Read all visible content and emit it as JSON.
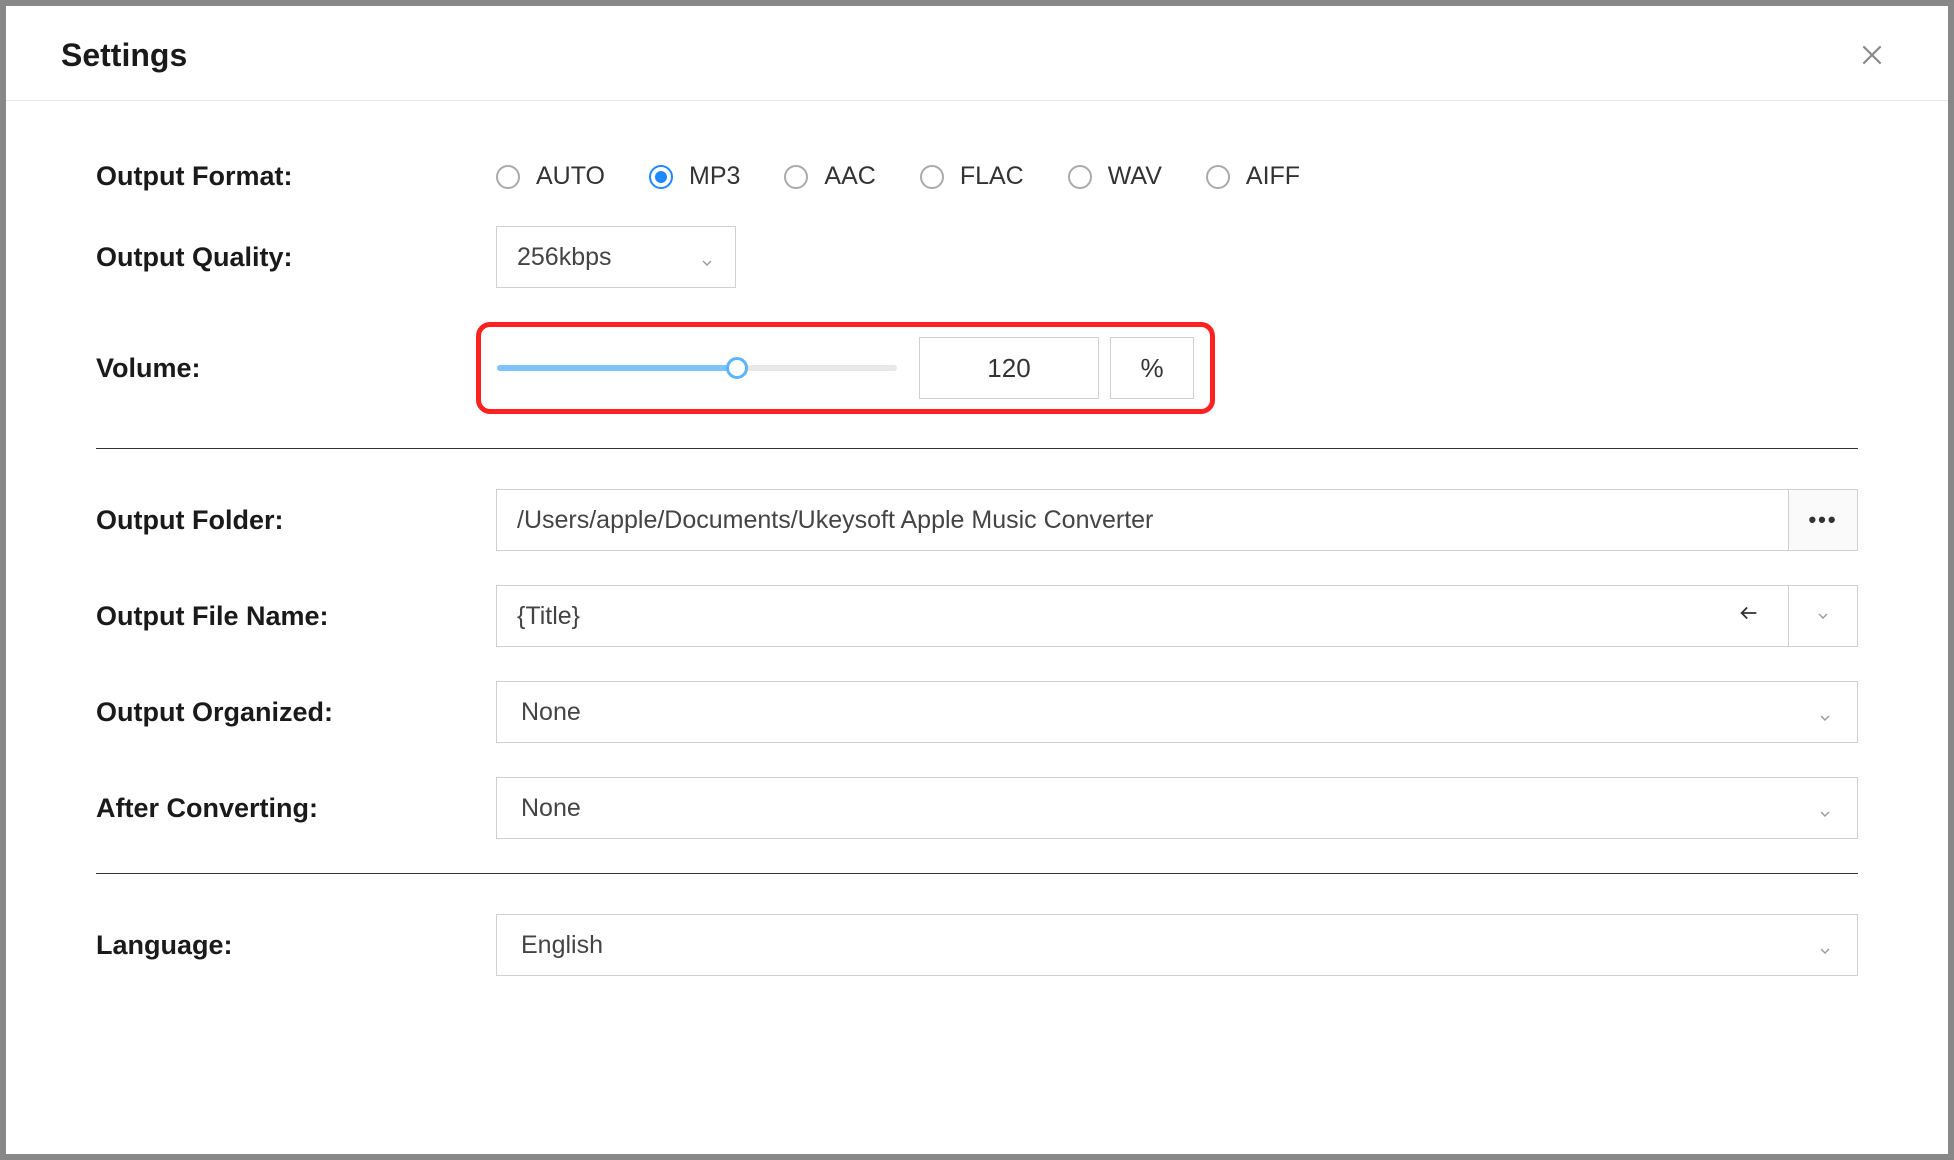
{
  "dialog": {
    "title": "Settings"
  },
  "outputFormat": {
    "label": "Output Format:",
    "options": [
      {
        "label": "AUTO",
        "checked": false
      },
      {
        "label": "MP3",
        "checked": true
      },
      {
        "label": "AAC",
        "checked": false
      },
      {
        "label": "FLAC",
        "checked": false
      },
      {
        "label": "WAV",
        "checked": false
      },
      {
        "label": "AIFF",
        "checked": false
      }
    ]
  },
  "outputQuality": {
    "label": "Output Quality:",
    "value": "256kbps"
  },
  "volume": {
    "label": "Volume:",
    "value": "120",
    "unit": "%",
    "percent": 60
  },
  "outputFolder": {
    "label": "Output Folder:",
    "value": "/Users/apple/Documents/Ukeysoft Apple Music Converter"
  },
  "outputFileName": {
    "label": "Output File Name:",
    "value": "{Title}"
  },
  "outputOrganized": {
    "label": "Output Organized:",
    "value": "None"
  },
  "afterConverting": {
    "label": "After Converting:",
    "value": "None"
  },
  "language": {
    "label": "Language:",
    "value": "English"
  }
}
